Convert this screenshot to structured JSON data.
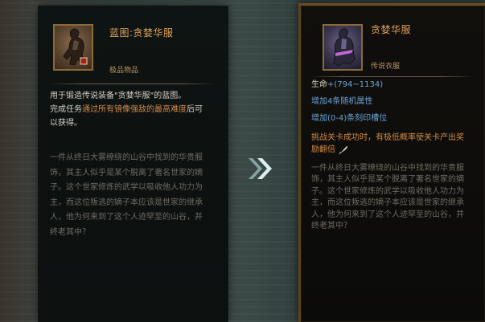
{
  "left": {
    "item_name": "蓝图:贪婪华服",
    "rarity": "极品物品",
    "desc_line1": "用于锻造传说装备\"贪婪华服\"的蓝图。",
    "task_prefix": "完成任务",
    "task_highlight": "通过所有镜像强敌的最高难度",
    "task_suffix": "后可",
    "task_line2": "以获得。",
    "lore": [
      "一件从终日大雾缭绕的山谷中找到的华贵服",
      "饰，其主人似乎是某个脱离了著名世家的嫡",
      "子。这个世家修炼的武学以吸收他人功力为",
      "主，而这位叛逃的嫡子本应该是世家的继承",
      "人，他为何来到了这个人迹罕至的山谷，并",
      "终老其中？"
    ]
  },
  "right": {
    "item_name": "贪婪华服",
    "rarity": "传说衣服",
    "stat_label": "生命",
    "stat_value": "+(794~1134)",
    "bonus1": "增加4条随机属性",
    "bonus2": "增加(0-4)条刻印槽位",
    "drop_line1": "挑战关卡成功时，有极低概率使关卡产出奖",
    "drop_line2": "励翻倍",
    "lore": [
      "一件从终日大雾缭绕的山谷中找到的华贵服",
      "饰，其主人似乎是某个脱离了著名世家的嫡",
      "子。这个世家修炼的武学以吸收他人功力为",
      "主，而这位叛逃的嫡子本应该是世家的继承",
      "人，他为何来到了这个人迹罕至的山谷，并",
      "终老其中？"
    ]
  },
  "icons": {
    "compare_arrow": "double-chevron-right-icon",
    "feather": "quill-icon"
  },
  "colors": {
    "name": "#e0a25c",
    "highlight": "#d08a48",
    "bonus": "#6aa4d8",
    "lore": "#6f6b63"
  }
}
